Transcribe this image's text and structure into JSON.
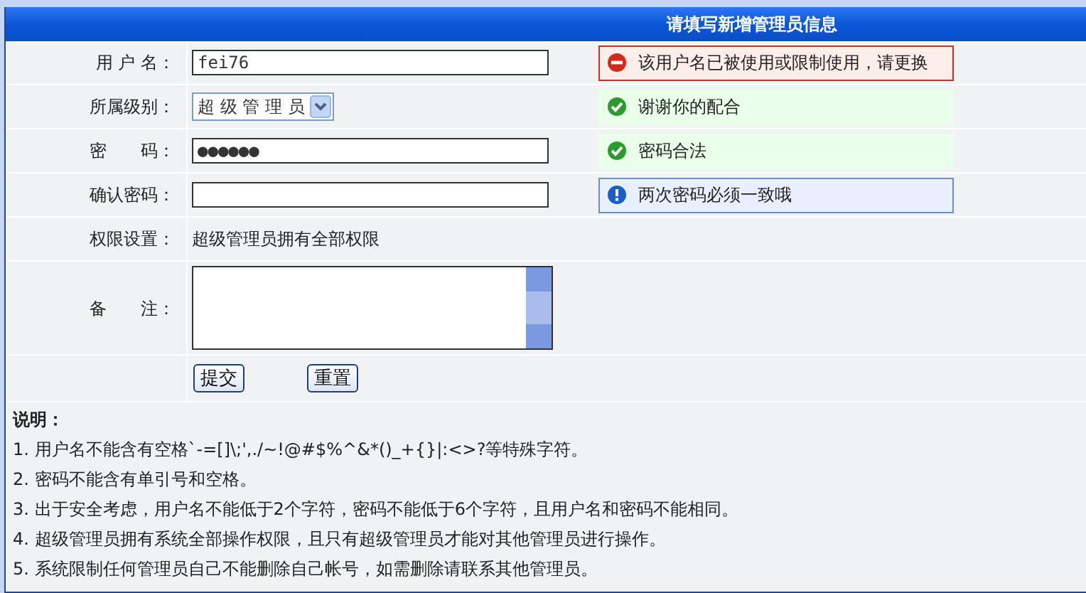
{
  "header": {
    "title": "请填写新增管理员信息"
  },
  "fields": [
    {
      "kind": "text",
      "label": "用 户 名：",
      "value": "fei76",
      "message": {
        "kind": "error",
        "text": "该用户名已被使用或限制使用，请更换"
      }
    },
    {
      "kind": "select",
      "label": "所属级别：",
      "value": "超 级 管 理 员",
      "message": {
        "kind": "ok",
        "text": "谢谢你的配合"
      }
    },
    {
      "kind": "text",
      "label": "密　　码：",
      "value": "●●●●●●",
      "message": {
        "kind": "ok",
        "text": "密码合法"
      }
    },
    {
      "kind": "text",
      "label": "确认密码：",
      "message": {
        "kind": "info",
        "text": "两次密码必须一致哦"
      }
    },
    {
      "kind": "static",
      "label": "权限设置：",
      "value": "超级管理员拥有全部权限"
    },
    {
      "kind": "textarea",
      "label": "备　　注："
    }
  ],
  "buttons": [
    "提交",
    "重置"
  ],
  "notes": {
    "title": "说明：",
    "items": [
      "1. 用户名不能含有空格`-=[]\\;',./~!@#$%^&*()_+{}|:<>?等特殊字符。",
      "2. 密码不能含有单引号和空格。",
      "3. 出于安全考虑，用户名不能低于2个字符，密码不能低于6个字符，且用户名和密码不能相同。",
      "4. 超级管理员拥有系统全部操作权限，且只有超级管理员才能对其他管理员进行操作。",
      "5. 系统限制任何管理员自己不能删除自己帐号，如需删除请联系其他管理员。"
    ]
  }
}
